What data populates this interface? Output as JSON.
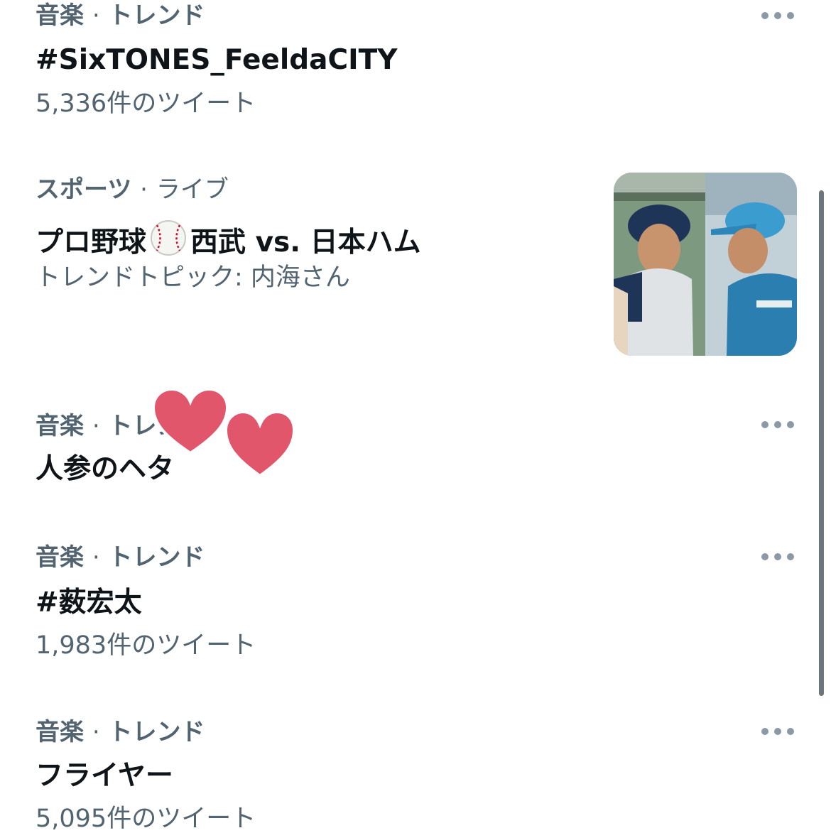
{
  "trends": [
    {
      "category": "音楽",
      "separator": "·",
      "status": "トレンド",
      "title": "#SixTONES_FeeldaCITY",
      "count": "5,336件のツイート"
    },
    {
      "category": "スポーツ",
      "separator": "·",
      "status": "ライブ",
      "title_before": "プロ野球",
      "title_after": "西武 vs. 日本ハム",
      "topic": "トレンドトピック: 内海さん"
    },
    {
      "category": "音楽",
      "separator": "·",
      "status": "トレンド",
      "title": "人参のヘタ"
    },
    {
      "category": "音楽",
      "separator": "·",
      "status": "トレンド",
      "title": "#薮宏太",
      "count": "1,983件のツイート"
    },
    {
      "category": "音楽",
      "separator": "·",
      "status": "トレンド",
      "title": "フライヤー",
      "count": "5,095件のツイート"
    }
  ],
  "icons": {
    "more": "more-horizontal-icon",
    "baseball": "baseball-icon",
    "heart": "heart-sticker"
  },
  "colors": {
    "text_primary": "#0f1419",
    "text_secondary": "#536471",
    "heart": "#e2566b"
  }
}
